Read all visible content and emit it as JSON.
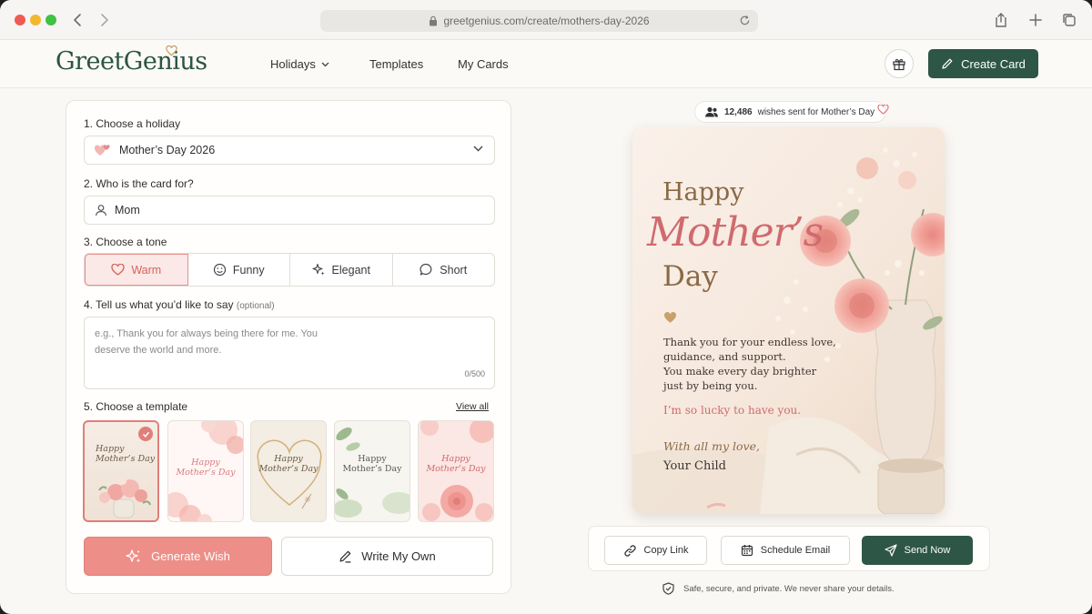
{
  "browser": {
    "url": "greetgenius.com/create/mothers-day-2026"
  },
  "header": {
    "logo_part1": "Greet",
    "logo_part2": "Genius",
    "nav": [
      {
        "label": "Holidays"
      },
      {
        "label": "Templates"
      },
      {
        "label": "My Cards"
      }
    ],
    "create_label": "Create Card"
  },
  "form": {
    "step1_label": "1. Choose a holiday",
    "holiday_value": "Mother’s Day 2026",
    "step2_label": "2. Who is the card for?",
    "recipient_value": "Mom",
    "step3_label": "3. Choose a tone",
    "tones": [
      {
        "label": "Warm",
        "icon": "heart-icon",
        "selected": true
      },
      {
        "label": "Funny",
        "icon": "smile-icon",
        "selected": false
      },
      {
        "label": "Elegant",
        "icon": "sparkle-icon",
        "selected": false
      },
      {
        "label": "Short",
        "icon": "chat-bubble-icon",
        "selected": false
      }
    ],
    "step4_label": "4. Tell us what you’d like to say",
    "step4_optional": "(optional)",
    "message_placeholder_line1": "e.g., Thank you for always being there for me. You",
    "message_placeholder_line2": "deserve the world and more.",
    "char_counter": "0/500",
    "step5_label": "5. Choose a template",
    "view_all": "View all",
    "templates": [
      {
        "line1": "Happy",
        "line2": "Mother’s Day",
        "selected": true
      },
      {
        "line1": "Happy",
        "line2": "Mother’s Day",
        "selected": false
      },
      {
        "line1": "Happy",
        "line2": "Mother’s Day",
        "selected": false
      },
      {
        "line1": "Happy",
        "line2": "Mother’s Day",
        "selected": false
      },
      {
        "line1": "Happy",
        "line2": "Mother’s Day",
        "selected": false
      }
    ],
    "generate_label": "Generate Wish",
    "write_own_label": "Write My Own"
  },
  "preview": {
    "wishes_count": "12,486",
    "wishes_text": "wishes sent for Mother’s Day",
    "card_happy": "Happy",
    "card_mothers": "Mother’s",
    "card_day": "Day",
    "card_msg_1": "Thank you for your endless love,",
    "card_msg_2": "guidance, and support.",
    "card_msg_3": "You make every day brighter",
    "card_msg_4": "just by being you.",
    "card_lucky": "I’m so lucky to have you.",
    "card_with_love": "With all my love,",
    "card_signature": "Your Child"
  },
  "actions": {
    "copy_link": "Copy Link",
    "schedule_email": "Schedule Email",
    "send_now": "Send Now",
    "safe_note": "Safe, secure, and private. We never share your details."
  },
  "colors": {
    "brand_green": "#2d5647",
    "accent_coral": "#ee8e88",
    "accent_gold": "#c4945a"
  }
}
